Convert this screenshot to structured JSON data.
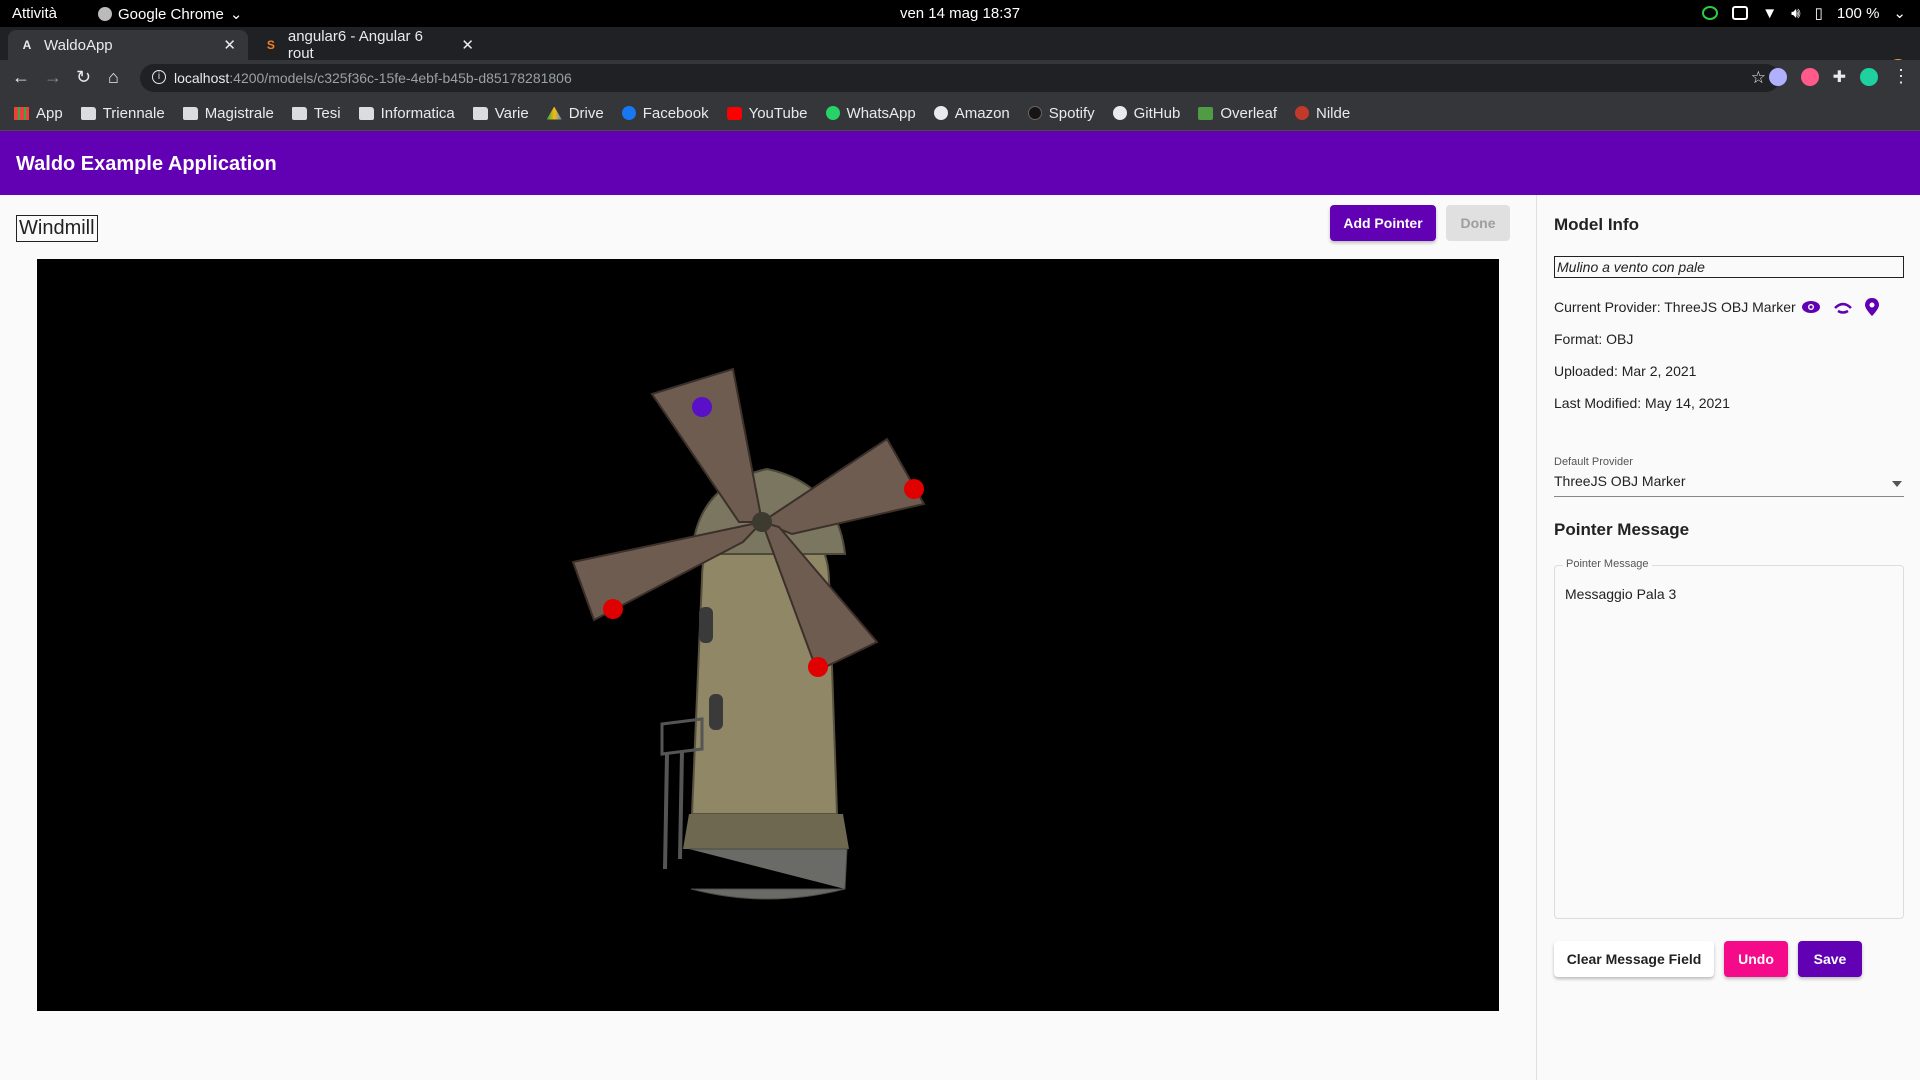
{
  "os": {
    "activities": "Attività",
    "app_name": "Google Chrome",
    "clock": "ven 14 mag  18:37",
    "battery": "100 %"
  },
  "browser": {
    "tabs": [
      {
        "title": "WaldoApp",
        "favicon": "A"
      },
      {
        "title": "angular6 - Angular 6 rout",
        "favicon": "S"
      }
    ],
    "url_host": "localhost",
    "url_path": ":4200/models/c325f36c-15fe-4ebf-b45b-d85178281806",
    "bookmarks": [
      {
        "label": "App",
        "icon": "apps-icon"
      },
      {
        "label": "Triennale",
        "icon": "folder-icon"
      },
      {
        "label": "Magistrale",
        "icon": "folder-icon"
      },
      {
        "label": "Tesi",
        "icon": "folder-icon"
      },
      {
        "label": "Informatica",
        "icon": "folder-icon"
      },
      {
        "label": "Varie",
        "icon": "folder-icon"
      },
      {
        "label": "Drive",
        "icon": "drive-icon"
      },
      {
        "label": "Facebook",
        "icon": "facebook-icon"
      },
      {
        "label": "YouTube",
        "icon": "youtube-icon"
      },
      {
        "label": "WhatsApp",
        "icon": "whatsapp-icon"
      },
      {
        "label": "Amazon",
        "icon": "amazon-icon"
      },
      {
        "label": "Spotify",
        "icon": "spotify-icon"
      },
      {
        "label": "GitHub",
        "icon": "github-icon"
      },
      {
        "label": "Overleaf",
        "icon": "overleaf-icon"
      },
      {
        "label": "Nilde",
        "icon": "nilde-icon"
      }
    ]
  },
  "app": {
    "title": "Waldo Example Application"
  },
  "model": {
    "name": "Windmill",
    "add_pointer_label": "Add Pointer",
    "done_label": "Done"
  },
  "panel": {
    "heading": "Model Info",
    "description": "Mulino a vento con pale",
    "current_provider": "Current Provider: ThreeJS OBJ Marker",
    "format": "Format: OBJ",
    "uploaded": "Uploaded: Mar 2, 2021",
    "last_modified": "Last Modified: May 14, 2021",
    "default_provider_label": "Default Provider",
    "default_provider_value": "ThreeJS OBJ Marker",
    "pointer_heading": "Pointer Message",
    "pointer_field_label": "Pointer Message",
    "pointer_message": "Messaggio Pala 3",
    "clear_label": "Clear Message Field",
    "undo_label": "Undo",
    "save_label": "Save"
  },
  "colors": {
    "primary": "#6200b3",
    "accent": "#f50a8a",
    "marker_selected": "#5a10c8",
    "marker": "#e00000"
  }
}
